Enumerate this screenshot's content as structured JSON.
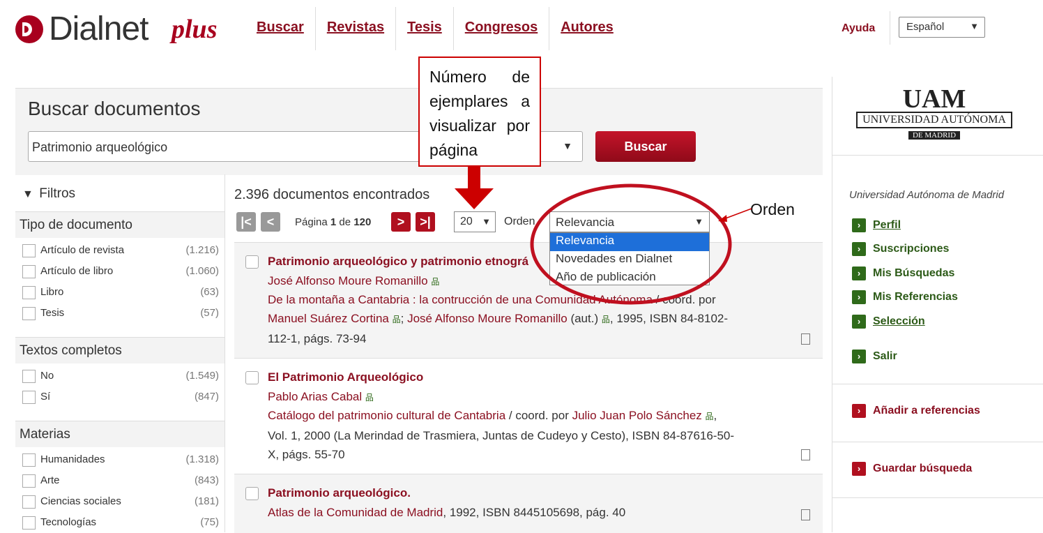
{
  "header": {
    "logo_text": "Dialnet",
    "logo_plus": "plus",
    "nav": [
      "Buscar",
      "Revistas",
      "Tesis",
      "Congresos",
      "Autores"
    ],
    "help": "Ayuda",
    "language": "Español"
  },
  "search": {
    "title": "Buscar documentos",
    "query": "Patrimonio arqueológico",
    "button": "Buscar"
  },
  "filters": {
    "title": "Filtros",
    "groups": [
      {
        "title": "Tipo de documento",
        "items": [
          {
            "label": "Artículo de revista",
            "count": "(1.216)"
          },
          {
            "label": "Artículo de libro",
            "count": "(1.060)"
          },
          {
            "label": "Libro",
            "count": "(63)"
          },
          {
            "label": "Tesis",
            "count": "(57)"
          }
        ]
      },
      {
        "title": "Textos completos",
        "items": [
          {
            "label": "No",
            "count": "(1.549)"
          },
          {
            "label": "Sí",
            "count": "(847)"
          }
        ]
      },
      {
        "title": "Materias",
        "items": [
          {
            "label": "Humanidades",
            "count": "(1.318)"
          },
          {
            "label": "Arte",
            "count": "(843)"
          },
          {
            "label": "Ciencias sociales",
            "count": "(181)"
          },
          {
            "label": "Tecnologías",
            "count": "(75)"
          }
        ]
      }
    ]
  },
  "results": {
    "count_text": "2.396 documentos encontrados",
    "pagination": {
      "prefix": "Página",
      "current": "1",
      "middle": "de",
      "total": "120"
    },
    "per_page": "20",
    "order_label": "Orden",
    "order_selected": "Relevancia",
    "order_options": [
      "Relevancia",
      "Novedades en Dialnet",
      "Año de publicación"
    ],
    "items": [
      {
        "title": "Patrimonio arqueológico y patrimonio etnográ",
        "author": "José Alfonso Moure Romanillo",
        "source": "De la montaña a Cantabria : la contrucción de una Comunidad Autónoma",
        "source_tail": " / coord. por",
        "editors": "Manuel Suárez Cortina",
        "sep": ";",
        "editor2": "José Alfonso Moure Romanillo",
        "editor2_role": " (aut.)",
        "details": ", 1995, ISBN 84-8102-",
        "details2": "112-1, págs. 73-94"
      },
      {
        "title": "El Patrimonio Arqueológico",
        "author": "Pablo Arias Cabal",
        "source": "Catálogo del patrimonio cultural de Cantabria",
        "source_tail": " / coord. por ",
        "editors": "Julio Juan Polo Sánchez",
        "details": ",",
        "details2": "Vol. 1, 2000 (La Merindad de Trasmiera, Juntas de Cudeyo y Cesto), ISBN 84-87616-50-",
        "details3": "X, págs. 55-70"
      },
      {
        "title": "Patrimonio arqueológico.",
        "source": "Atlas de la Comunidad de Madrid",
        "details": ", 1992, ISBN 8445105698, pág. 40"
      }
    ]
  },
  "sidebar": {
    "logo_line1": "UAM",
    "logo_line2": "UNIVERSIDAD AUTÓNOMA",
    "logo_line3": "DE MADRID",
    "institution": "Universidad Autónoma de Madrid",
    "links": [
      "Perfil",
      "Suscripciones",
      "Mis Búsquedas",
      "Mis Referencias",
      "Selección"
    ],
    "logout": "Salir",
    "add_refs": "Añadir a referencias",
    "save_search": "Guardar búsqueda"
  },
  "annotations": {
    "per_page_note": "Número de ejemplares a visualizar por página",
    "order_note": "Orden"
  },
  "colors": {
    "brand": "#a8001e",
    "link": "#8b1021",
    "green": "#2f6a1a",
    "annotation": "#cc0000"
  }
}
